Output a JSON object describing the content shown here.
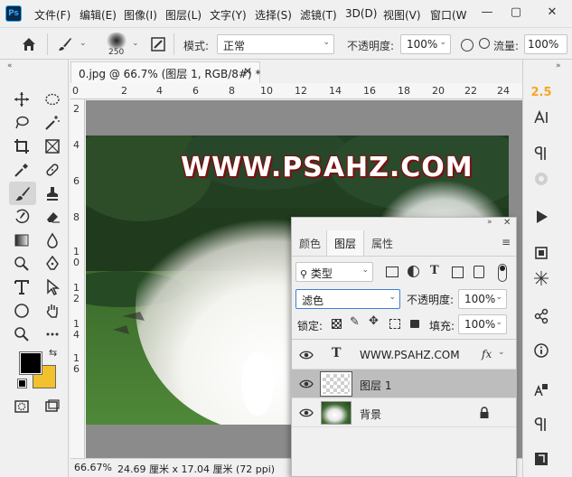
{
  "app": {
    "logo": "Ps"
  },
  "menu": [
    "文件(F)",
    "编辑(E)",
    "图像(I)",
    "图层(L)",
    "文字(Y)",
    "选择(S)",
    "滤镜(T)",
    "3D(D)",
    "视图(V)",
    "窗口(W"
  ],
  "window_controls": {
    "minimize": "—",
    "restore": "▢",
    "close": "✕"
  },
  "options": {
    "brush_size": "250",
    "mode_label": "模式:",
    "mode_value": "正常",
    "opacity_label": "不透明度:",
    "opacity_value": "100%",
    "flow_label": "流量:",
    "flow_value": "100%"
  },
  "document": {
    "tab_title": "0.jpg @ 66.7% (图层 1, RGB/8#) *",
    "close": "✕",
    "canvas_text": "WWW.PSAHZ.COM",
    "ruler_top": [
      "0",
      "2",
      "4",
      "6",
      "8",
      "10",
      "12",
      "14",
      "16",
      "18",
      "20",
      "22",
      "24"
    ],
    "ruler_left": [
      "2",
      "4",
      "6",
      "8",
      "1",
      "0",
      "1",
      "2",
      "1",
      "4",
      "1",
      "6"
    ],
    "status": {
      "zoom": "66.67%",
      "info": "24.69 厘米 x 17.04 厘米 (72 ppi)"
    }
  },
  "right_strip": {
    "version_badge": "2.5"
  },
  "layers_panel": {
    "tabs": [
      "颜色",
      "图层",
      "属性"
    ],
    "active_tab": "图层",
    "filter_type": "类型",
    "blend_mode": "滤色",
    "opacity_label": "不透明度:",
    "opacity_value": "100%",
    "lock_label": "锁定:",
    "fill_label": "填充:",
    "fill_value": "100%",
    "layers": [
      {
        "name": "WWW.PSAHZ.COM",
        "type": "text",
        "fx": "fx",
        "selected": false
      },
      {
        "name": "图层 1",
        "type": "transparent",
        "selected": true
      },
      {
        "name": "背景",
        "type": "image",
        "locked": true,
        "selected": false
      }
    ]
  },
  "colors": {
    "foreground": "#000000",
    "background": "#f2c12e",
    "accent": "#31a8ff",
    "badge": "#f5a623"
  }
}
